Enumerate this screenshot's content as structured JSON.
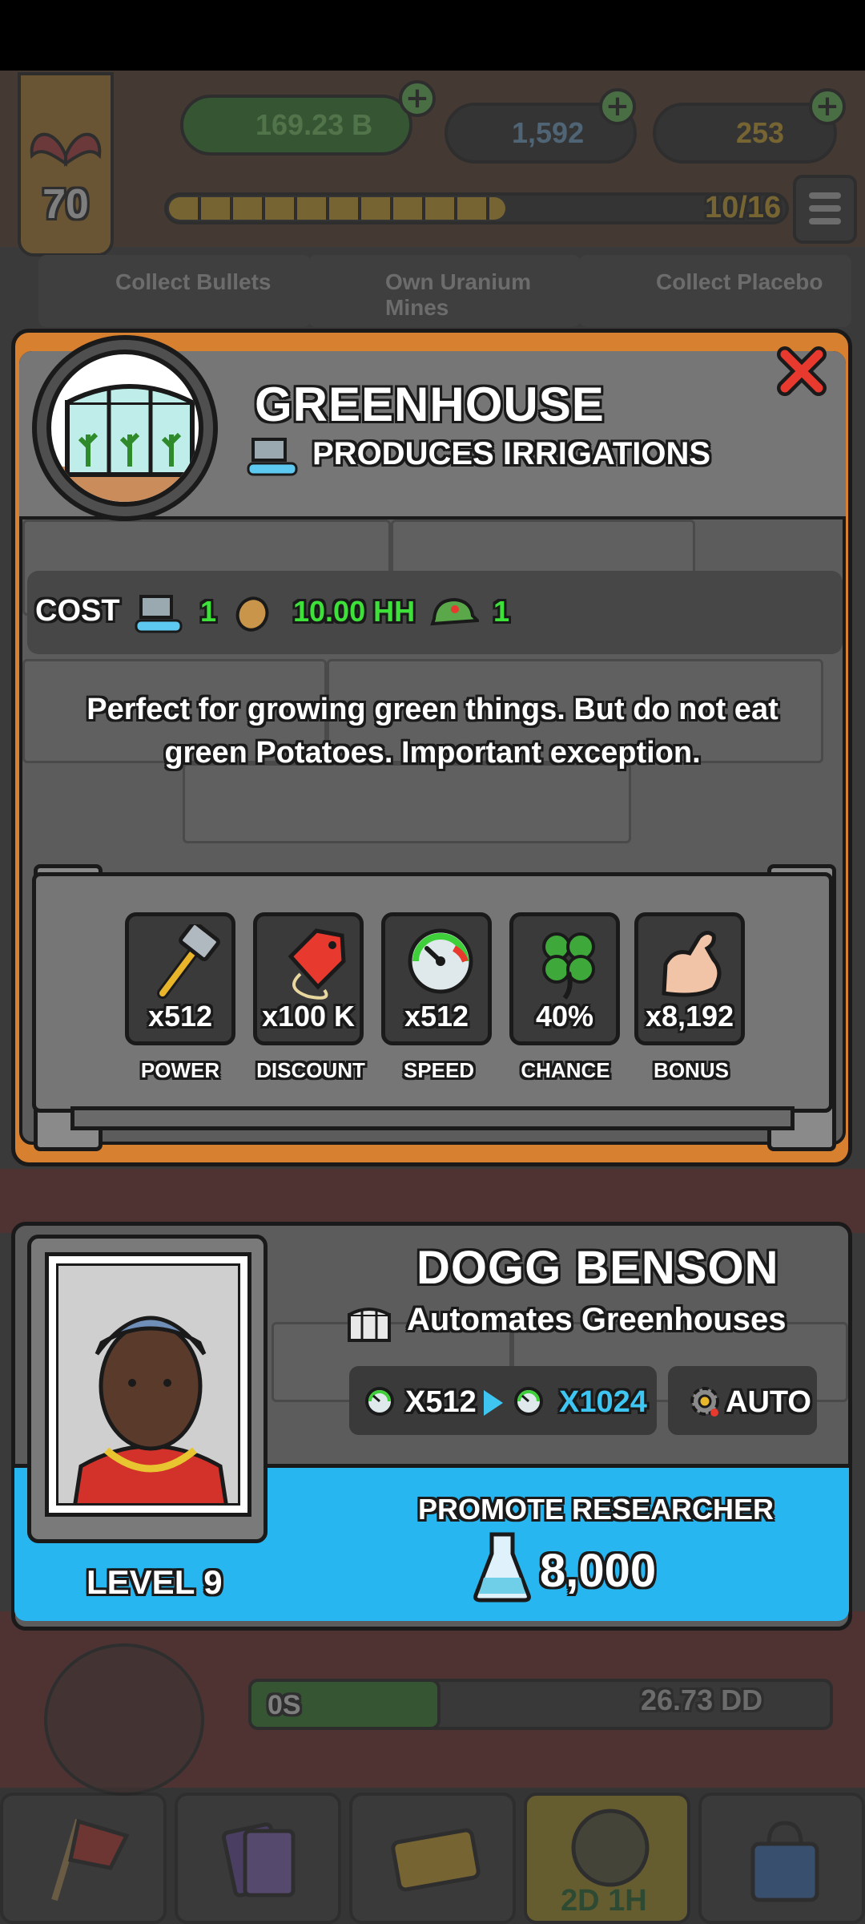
{
  "header": {
    "level": "70",
    "cash": "169.23 B",
    "flasks": "1,592",
    "gold": "253",
    "progress_text": "10/16",
    "progress_fraction": 0.625
  },
  "missions": [
    "Collect Bullets",
    "Own Uranium Mines",
    "Collect Placebo"
  ],
  "building": {
    "title": "GREENHOUSE",
    "produces": "PRODUCES IRRIGATIONS",
    "cost_label": "COST",
    "cost_irrigation": "1",
    "cost_potato": "10.00 HH",
    "cost_hat": "1",
    "description": "Perfect for growing green things. But do not eat green Potatoes. Important exception.",
    "stats": [
      {
        "value": "x512",
        "label": "POWER",
        "icon": "hammer-icon"
      },
      {
        "value": "x100 K",
        "label": "DISCOUNT",
        "icon": "price-tag-icon"
      },
      {
        "value": "x512",
        "label": "SPEED",
        "icon": "speedometer-icon"
      },
      {
        "value": "40%",
        "label": "CHANCE",
        "icon": "clover-icon"
      },
      {
        "value": "x8,192",
        "label": "BONUS",
        "icon": "muscle-icon"
      }
    ]
  },
  "background_row": {
    "timer": "0S",
    "value": "26.73 DD"
  },
  "researcher": {
    "name": "DOGG BENSON",
    "automates": "Automates Greenhouses",
    "speed_current": "X512",
    "speed_next": "X1024",
    "auto_label": "AUTO",
    "level": "LEVEL 9",
    "promote_label": "PROMOTE RESEARCHER",
    "promote_cost": "8,000"
  },
  "nav": {
    "timer": "2D 1H"
  },
  "colors": {
    "accent_green": "#3ee03a",
    "accent_blue": "#27b6ef",
    "panel_orange": "#d78130"
  }
}
